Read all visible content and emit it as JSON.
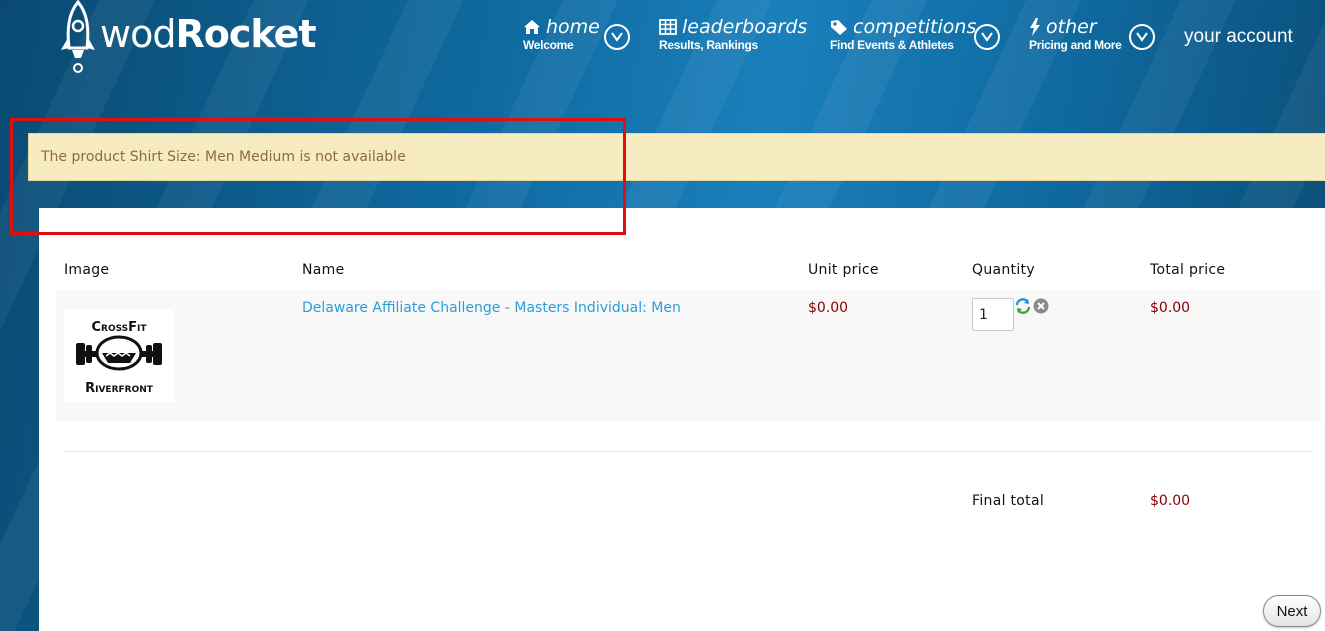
{
  "header": {
    "logo": {
      "wod": "wod",
      "rocket": "Rocket"
    },
    "nav": [
      {
        "title": "home",
        "subtitle": "Welcome",
        "icon": "house-icon"
      },
      {
        "title": "leaderboards",
        "subtitle": "Results, Rankings",
        "icon": "table-icon"
      },
      {
        "title": "competitions",
        "subtitle": "Find Events & Athletes",
        "icon": "tag-icon"
      },
      {
        "title": "other",
        "subtitle": "Pricing and More",
        "icon": "lightning-icon"
      }
    ],
    "account": "your account"
  },
  "alert": {
    "message": "The product Shirt Size: Men Medium is not available"
  },
  "cart": {
    "columns": {
      "image": "Image",
      "name": "Name",
      "unit_price": "Unit price",
      "quantity": "Quantity",
      "total_price": "Total price"
    },
    "items": [
      {
        "image_text": {
          "top": "CrossFit",
          "bottom": "Riverfront"
        },
        "name": "Delaware Affiliate Challenge - Masters Individual: Men",
        "unit_price": "$0.00",
        "quantity": "1",
        "total_price": "$0.00"
      }
    ],
    "final_total_label": "Final total",
    "final_total": "$0.00",
    "next_label": "Next"
  },
  "colors": {
    "link": "#2a9fd8",
    "price": "#8b0000",
    "alert_bg": "#f7ebc2",
    "alert_text": "#8a6d3b",
    "highlight": "#e01010"
  }
}
